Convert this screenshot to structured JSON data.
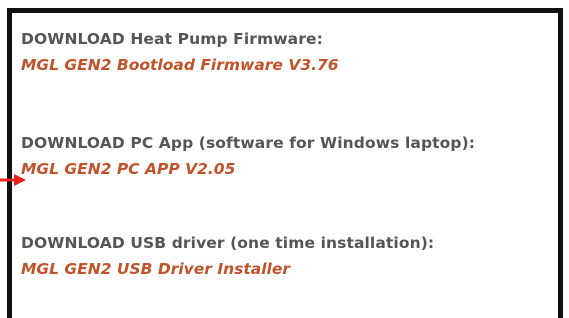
{
  "sections": [
    {
      "heading": "DOWNLOAD Heat Pump Firmware:",
      "link": "MGL GEN2 Bootload Firmware V3.76"
    },
    {
      "heading": "DOWNLOAD PC App (software for Windows laptop):",
      "link": "MGL GEN2 PC APP V2.05"
    },
    {
      "heading": "DOWNLOAD USB driver (one time installation):",
      "link": "MGL GEN2 USB Driver Installer"
    }
  ],
  "colors": {
    "border": "#111111",
    "heading": "#555555",
    "link": "#c0532a",
    "arrow": "#e8201e"
  },
  "icons": {
    "pointer": "red-arrow-icon"
  }
}
